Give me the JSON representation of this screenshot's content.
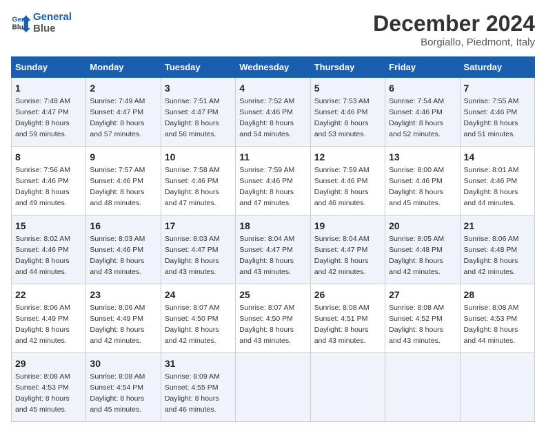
{
  "header": {
    "logo_line1": "General",
    "logo_line2": "Blue",
    "main_title": "December 2024",
    "subtitle": "Borgiallo, Piedmont, Italy"
  },
  "weekdays": [
    "Sunday",
    "Monday",
    "Tuesday",
    "Wednesday",
    "Thursday",
    "Friday",
    "Saturday"
  ],
  "weeks": [
    [
      {
        "day": "1",
        "sunrise": "7:48 AM",
        "sunset": "4:47 PM",
        "daylight": "8 hours and 59 minutes."
      },
      {
        "day": "2",
        "sunrise": "7:49 AM",
        "sunset": "4:47 PM",
        "daylight": "8 hours and 57 minutes."
      },
      {
        "day": "3",
        "sunrise": "7:51 AM",
        "sunset": "4:47 PM",
        "daylight": "8 hours and 56 minutes."
      },
      {
        "day": "4",
        "sunrise": "7:52 AM",
        "sunset": "4:46 PM",
        "daylight": "8 hours and 54 minutes."
      },
      {
        "day": "5",
        "sunrise": "7:53 AM",
        "sunset": "4:46 PM",
        "daylight": "8 hours and 53 minutes."
      },
      {
        "day": "6",
        "sunrise": "7:54 AM",
        "sunset": "4:46 PM",
        "daylight": "8 hours and 52 minutes."
      },
      {
        "day": "7",
        "sunrise": "7:55 AM",
        "sunset": "4:46 PM",
        "daylight": "8 hours and 51 minutes."
      }
    ],
    [
      {
        "day": "8",
        "sunrise": "7:56 AM",
        "sunset": "4:46 PM",
        "daylight": "8 hours and 49 minutes."
      },
      {
        "day": "9",
        "sunrise": "7:57 AM",
        "sunset": "4:46 PM",
        "daylight": "8 hours and 48 minutes."
      },
      {
        "day": "10",
        "sunrise": "7:58 AM",
        "sunset": "4:46 PM",
        "daylight": "8 hours and 47 minutes."
      },
      {
        "day": "11",
        "sunrise": "7:59 AM",
        "sunset": "4:46 PM",
        "daylight": "8 hours and 47 minutes."
      },
      {
        "day": "12",
        "sunrise": "7:59 AM",
        "sunset": "4:46 PM",
        "daylight": "8 hours and 46 minutes."
      },
      {
        "day": "13",
        "sunrise": "8:00 AM",
        "sunset": "4:46 PM",
        "daylight": "8 hours and 45 minutes."
      },
      {
        "day": "14",
        "sunrise": "8:01 AM",
        "sunset": "4:46 PM",
        "daylight": "8 hours and 44 minutes."
      }
    ],
    [
      {
        "day": "15",
        "sunrise": "8:02 AM",
        "sunset": "4:46 PM",
        "daylight": "8 hours and 44 minutes."
      },
      {
        "day": "16",
        "sunrise": "8:03 AM",
        "sunset": "4:46 PM",
        "daylight": "8 hours and 43 minutes."
      },
      {
        "day": "17",
        "sunrise": "8:03 AM",
        "sunset": "4:47 PM",
        "daylight": "8 hours and 43 minutes."
      },
      {
        "day": "18",
        "sunrise": "8:04 AM",
        "sunset": "4:47 PM",
        "daylight": "8 hours and 43 minutes."
      },
      {
        "day": "19",
        "sunrise": "8:04 AM",
        "sunset": "4:47 PM",
        "daylight": "8 hours and 42 minutes."
      },
      {
        "day": "20",
        "sunrise": "8:05 AM",
        "sunset": "4:48 PM",
        "daylight": "8 hours and 42 minutes."
      },
      {
        "day": "21",
        "sunrise": "8:06 AM",
        "sunset": "4:48 PM",
        "daylight": "8 hours and 42 minutes."
      }
    ],
    [
      {
        "day": "22",
        "sunrise": "8:06 AM",
        "sunset": "4:49 PM",
        "daylight": "8 hours and 42 minutes."
      },
      {
        "day": "23",
        "sunrise": "8:06 AM",
        "sunset": "4:49 PM",
        "daylight": "8 hours and 42 minutes."
      },
      {
        "day": "24",
        "sunrise": "8:07 AM",
        "sunset": "4:50 PM",
        "daylight": "8 hours and 42 minutes."
      },
      {
        "day": "25",
        "sunrise": "8:07 AM",
        "sunset": "4:50 PM",
        "daylight": "8 hours and 43 minutes."
      },
      {
        "day": "26",
        "sunrise": "8:08 AM",
        "sunset": "4:51 PM",
        "daylight": "8 hours and 43 minutes."
      },
      {
        "day": "27",
        "sunrise": "8:08 AM",
        "sunset": "4:52 PM",
        "daylight": "8 hours and 43 minutes."
      },
      {
        "day": "28",
        "sunrise": "8:08 AM",
        "sunset": "4:53 PM",
        "daylight": "8 hours and 44 minutes."
      }
    ],
    [
      {
        "day": "29",
        "sunrise": "8:08 AM",
        "sunset": "4:53 PM",
        "daylight": "8 hours and 45 minutes."
      },
      {
        "day": "30",
        "sunrise": "8:08 AM",
        "sunset": "4:54 PM",
        "daylight": "8 hours and 45 minutes."
      },
      {
        "day": "31",
        "sunrise": "8:09 AM",
        "sunset": "4:55 PM",
        "daylight": "8 hours and 46 minutes."
      },
      null,
      null,
      null,
      null
    ]
  ],
  "labels": {
    "sunrise": "Sunrise:",
    "sunset": "Sunset:",
    "daylight": "Daylight:"
  }
}
